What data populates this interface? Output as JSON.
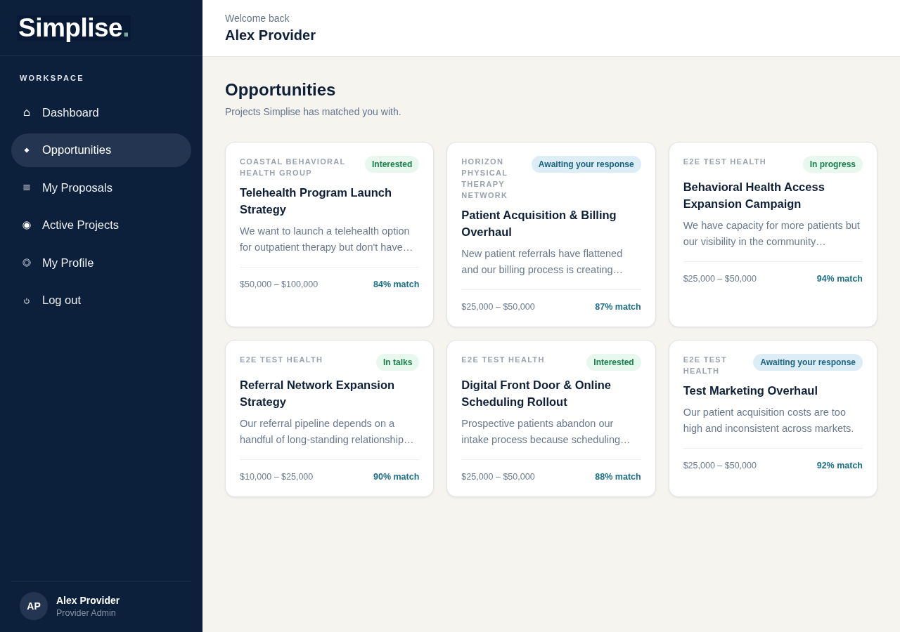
{
  "sidebar": {
    "logo": {
      "text": "Simplise",
      "dot": "."
    },
    "section_label": "WORKSPACE",
    "items": [
      {
        "label": "Dashboard",
        "selected": false
      },
      {
        "label": "Opportunities",
        "selected": true
      },
      {
        "label": "My Proposals",
        "selected": false
      },
      {
        "label": "Active Projects",
        "selected": false
      },
      {
        "label": "My Profile",
        "selected": false
      },
      {
        "label": "Log out",
        "selected": false
      }
    ],
    "user": {
      "initials": "AP",
      "name": "Alex Provider",
      "role": "Provider Admin"
    }
  },
  "header": {
    "greeting": "Welcome back",
    "name": "Alex Provider"
  },
  "page": {
    "title": "Opportunities",
    "subtitle": "Projects Simplise has matched you with."
  },
  "opportunities": [
    {
      "organization": "COASTAL BEHAVIORAL HEALTH GROUP",
      "status": {
        "label": "Interested",
        "kind": "positive"
      },
      "title": "Telehealth Program Launch Strategy",
      "description": "We want to launch a telehealth option for outpatient therapy but don't have…",
      "budget": "$50,000 – $100,000",
      "match": "84% match"
    },
    {
      "organization": "HORIZON PHYSICAL THERAPY NETWORK",
      "status": {
        "label": "Awaiting your response",
        "kind": "pending"
      },
      "title": "Patient Acquisition & Billing Overhaul",
      "description": "New patient referrals have flattened and our billing process is creating…",
      "budget": "$25,000 – $50,000",
      "match": "87% match"
    },
    {
      "organization": "E2E TEST HEALTH",
      "status": {
        "label": "In progress",
        "kind": "positive"
      },
      "title": "Behavioral Health Access Expansion Campaign",
      "description": "We have capacity for more patients but our visibility in the community…",
      "budget": "$25,000 – $50,000",
      "match": "94% match"
    },
    {
      "organization": "E2E TEST HEALTH",
      "status": {
        "label": "In talks",
        "kind": "positive"
      },
      "title": "Referral Network Expansion Strategy",
      "description": "Our referral pipeline depends on a handful of long-standing relationship…",
      "budget": "$10,000 – $25,000",
      "match": "90% match"
    },
    {
      "organization": "E2E TEST HEALTH",
      "status": {
        "label": "Interested",
        "kind": "positive"
      },
      "title": "Digital Front Door & Online Scheduling Rollout",
      "description": "Prospective patients abandon our intake process because scheduling…",
      "budget": "$25,000 – $50,000",
      "match": "88% match"
    },
    {
      "organization": "E2E TEST HEALTH",
      "status": {
        "label": "Awaiting your response",
        "kind": "pending"
      },
      "title": "Test Marketing Overhaul",
      "description": "Our patient acquisition costs are too high and inconsistent across markets.",
      "budget": "$25,000 – $50,000",
      "match": "92% match"
    }
  ]
}
